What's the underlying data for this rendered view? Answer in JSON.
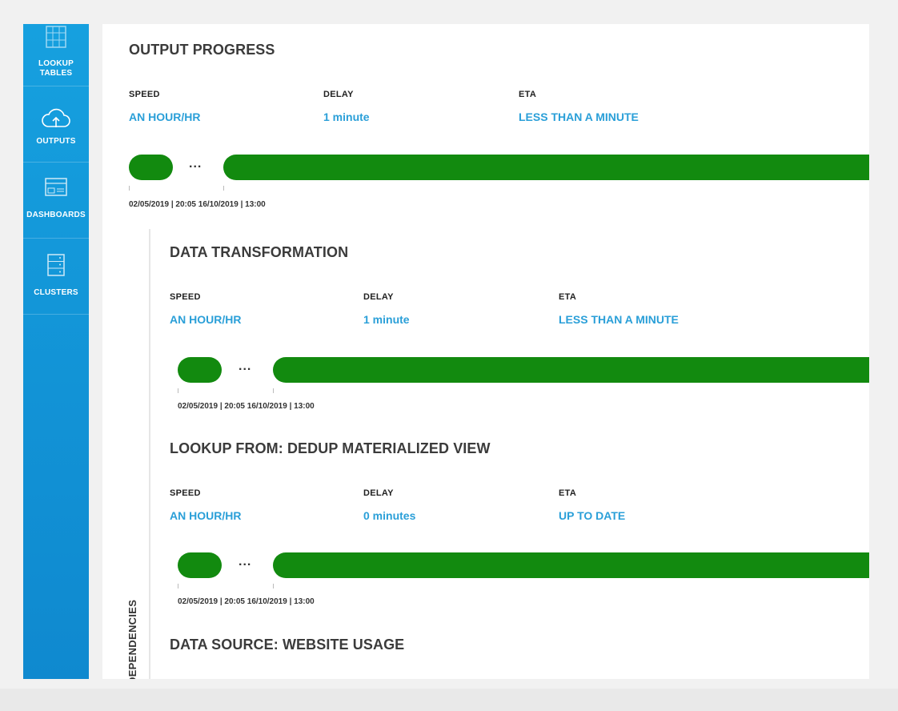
{
  "sidebar": {
    "items": [
      {
        "label_line1": "LOOKUP",
        "label_line2": "TABLES",
        "icon": "grid-icon"
      },
      {
        "label": "OUTPUTS",
        "icon": "cloud-upload-icon"
      },
      {
        "label": "DASHBOARDS",
        "icon": "dashboard-icon"
      },
      {
        "label": "CLUSTERS",
        "icon": "server-icon"
      }
    ]
  },
  "output": {
    "title": "OUTPUT PROGRESS",
    "speed_label": "SPEED",
    "speed_value": "AN HOUR/HR",
    "delay_label": "DELAY",
    "delay_value": "1  minute",
    "eta_label": "ETA",
    "eta_value": "LESS THAN A MINUTE",
    "ellipsis": "...",
    "dates": "02/05/2019 | 20:05 16/10/2019 | 13:00"
  },
  "dependencies_label": "DEPENDENCIES",
  "dependencies": [
    {
      "title": "DATA TRANSFORMATION",
      "speed_label": "SPEED",
      "speed_value": "AN HOUR/HR",
      "delay_label": "DELAY",
      "delay_value": "1  minute",
      "eta_label": "ETA",
      "eta_value": "LESS THAN A MINUTE",
      "ellipsis": "...",
      "dates": "02/05/2019 | 20:05 16/10/2019 | 13:00"
    },
    {
      "title": "LOOKUP FROM: DEDUP MATERIALIZED VIEW",
      "speed_label": "SPEED",
      "speed_value": "AN HOUR/HR",
      "delay_label": "DELAY",
      "delay_value": "0  minutes",
      "eta_label": "ETA",
      "eta_value": "UP TO DATE",
      "ellipsis": "...",
      "dates": "02/05/2019 | 20:05 16/10/2019 | 13:00"
    },
    {
      "title": "DATA SOURCE: WEBSITE USAGE"
    }
  ],
  "colors": {
    "sidebar_blue": "#1597d9",
    "value_blue": "#2a9fd8",
    "progress_green": "#128a0f"
  }
}
